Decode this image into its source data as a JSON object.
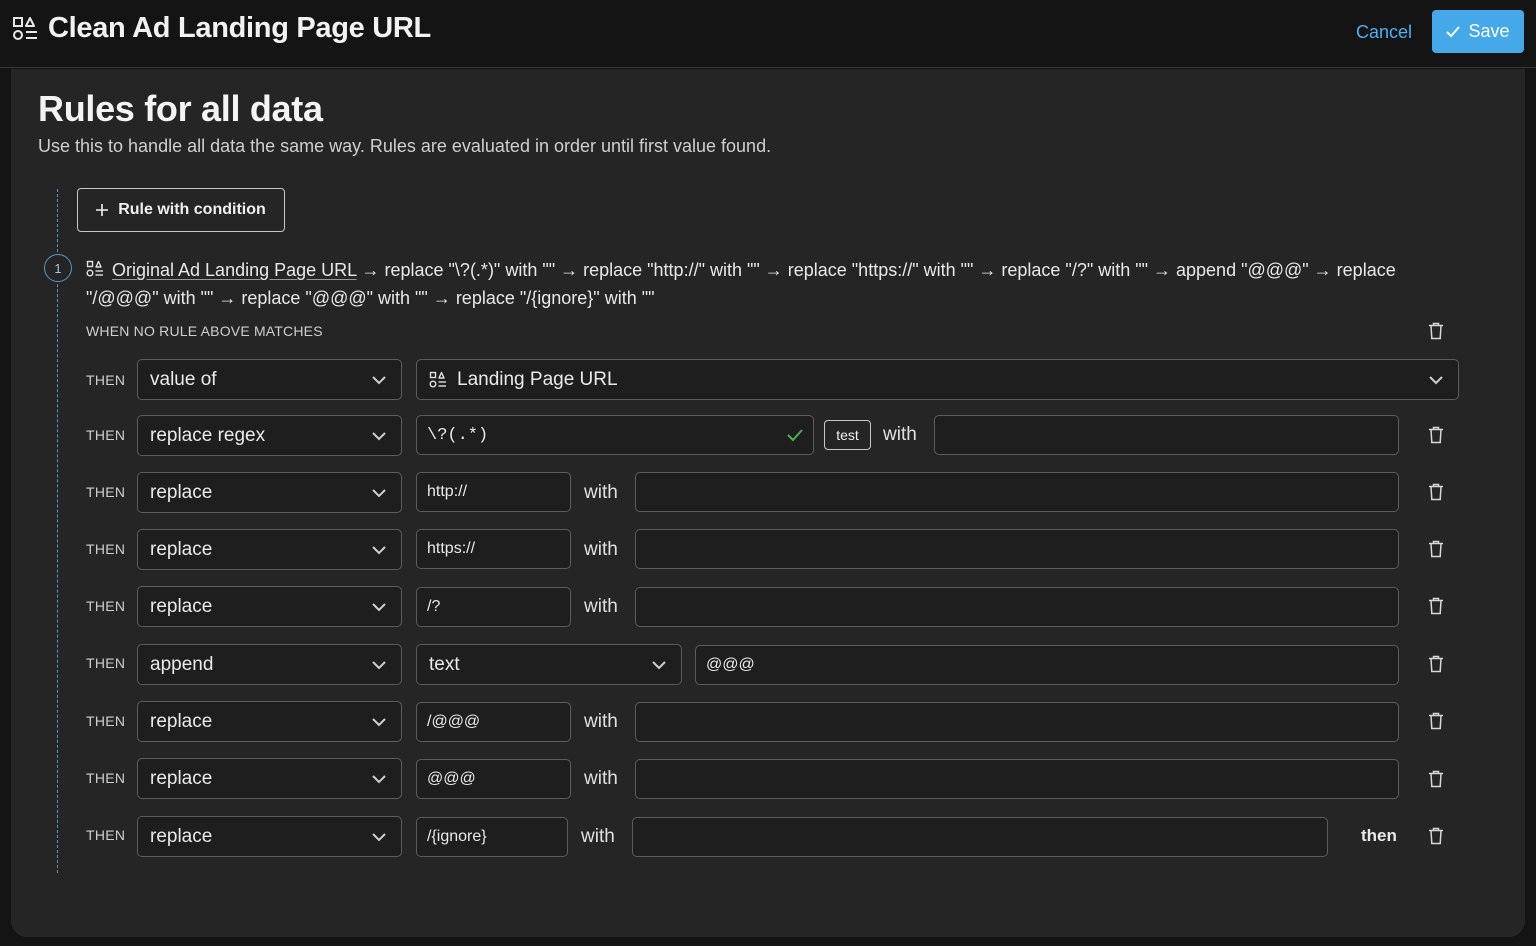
{
  "header": {
    "title": "Clean Ad Landing Page URL",
    "cancel_label": "Cancel",
    "save_label": "Save"
  },
  "section": {
    "heading": "Rules for all data",
    "description": "Use this to handle all data the same way. Rules are evaluated in order until first value found.",
    "add_rule_label": "Rule with condition"
  },
  "rule": {
    "index": "1",
    "source_field": "Original Ad Landing Page URL",
    "summary_rest": " → replace \"\\?(.*)\" with \"\" → replace \"http://\" with \"\" → replace \"https://\" with \"\" → replace \"/?\" with \"\" → append \"@@@\" → replace \"/@@@\" with \"\" → replace \"@@@\" with \"\" → replace \"/{ignore}\" with \"\"",
    "fallback_label": "WHEN NO RULE ABOVE MATCHES",
    "then_label": "THEN",
    "with_label": "with",
    "then_word": "then",
    "test_label": "test",
    "steps": [
      {
        "operation": "value of",
        "target": "Landing Page URL"
      },
      {
        "operation": "replace regex",
        "find": "\\?(.*)",
        "with": ""
      },
      {
        "operation": "replace",
        "find": "http://",
        "with": ""
      },
      {
        "operation": "replace",
        "find": "https://",
        "with": ""
      },
      {
        "operation": "replace",
        "find": "/?",
        "with": ""
      },
      {
        "operation": "append",
        "type": "text",
        "value": "@@@"
      },
      {
        "operation": "replace",
        "find": "/@@@",
        "with": ""
      },
      {
        "operation": "replace",
        "find": "@@@",
        "with": ""
      },
      {
        "operation": "replace",
        "find": "/{ignore}",
        "with": ""
      }
    ]
  },
  "colors": {
    "accent": "#45a8e8",
    "link": "#4fb0f0",
    "valid": "#4caf50",
    "background": "#141414",
    "panel": "#252525"
  }
}
